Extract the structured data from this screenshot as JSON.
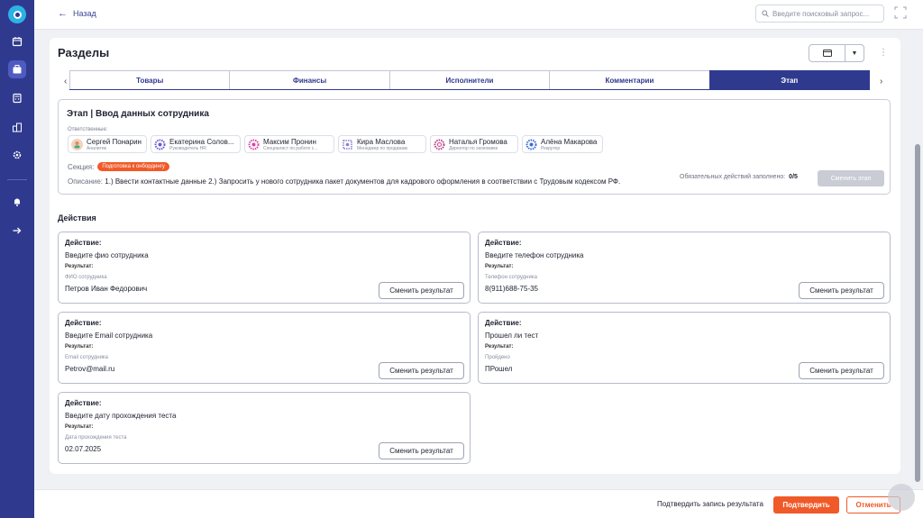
{
  "nav": {
    "icons": [
      "logo-icon",
      "calendar-icon",
      "briefcase-icon",
      "calculator-icon",
      "buildings-icon",
      "settings-icon",
      "bell-icon",
      "logout-icon"
    ]
  },
  "topbar": {
    "back_label": "Назад",
    "search_placeholder": "Введите поисковый запрос..."
  },
  "main": {
    "title": "Разделы"
  },
  "tabs": [
    {
      "label": "Товары",
      "active": false
    },
    {
      "label": "Финансы",
      "active": false
    },
    {
      "label": "Исполнители",
      "active": false
    },
    {
      "label": "Комментарии",
      "active": false
    },
    {
      "label": "Этап",
      "active": true
    }
  ],
  "stage": {
    "title": "Этап | Ввод данных сотрудника",
    "responsible_label": "Ответственные:",
    "people": [
      {
        "name": "Сергей Понарин",
        "role": "Аналитик",
        "color": "#e08a5a"
      },
      {
        "name": "Екатерина Солов...",
        "role": "Руководитель HR",
        "color": "#6a5acd"
      },
      {
        "name": "Максим Пронин",
        "role": "Специалист по работе с...",
        "color": "#d946a8"
      },
      {
        "name": "Кира Маслова",
        "role": "Менеджер по продажам",
        "color": "#8a7fd6"
      },
      {
        "name": "Наталья Громова",
        "role": "Директор по экономике",
        "color": "#c0408a"
      },
      {
        "name": "Алёна Макарова",
        "role": "Рекрутер",
        "color": "#3b6fd6"
      }
    ],
    "section_label": "Секция:",
    "section_badge": "Подготовка к онбордингу",
    "description_label": "Описание:",
    "description": "1.) Ввести контактные данные 2.) Запросить у нового сотрудника пакет документов для кадрового оформления в соответствии с Трудовым кодексом РФ.",
    "required_label": "Обязательных действий заполнено:",
    "required_value": "0/5",
    "change_stage_label": "Сменить этап"
  },
  "actions": {
    "heading": "Действия",
    "action_label": "Действие:",
    "result_label": "Результат:",
    "change_result_label": "Сменить результат",
    "items": [
      {
        "name": "Введите фио сотрудника",
        "field": "ФИО сотрудника",
        "value": "Петров Иван Федорович"
      },
      {
        "name": "Введите телефон сотрудника",
        "field": "Телефон сотрудника",
        "value": "8(911)688-75-35"
      },
      {
        "name": "Введите Email сотрудника",
        "field": "Email сотрудника",
        "value": "Petrov@mail.ru"
      },
      {
        "name": "Прошел ли тест",
        "field": "Пройдено",
        "value": "ПРошел"
      },
      {
        "name": "Введите дату прохождения теста",
        "field": "Дата прохождения теста",
        "value": "02.07.2025"
      }
    ]
  },
  "footer": {
    "confirm_text": "Подтвердить запись результата",
    "confirm_label": "Подтвердить",
    "cancel_label": "Отменить"
  },
  "colors": {
    "nav": "#2f3a8f",
    "accent": "#f05a28",
    "tab_active": "#2f3a8f"
  }
}
